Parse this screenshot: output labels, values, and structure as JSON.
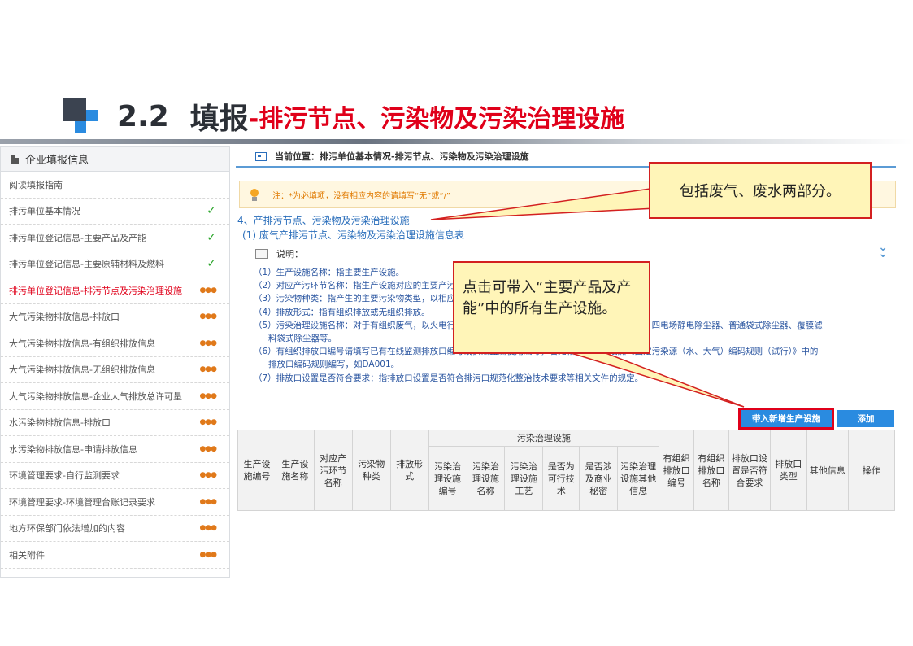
{
  "slide": {
    "number": "2.2",
    "title": "填报",
    "subtitle": "-排污节点、污染物及污染治理设施"
  },
  "sidebar": {
    "header": "企业填报信息",
    "items": [
      {
        "label": "阅读填报指南",
        "status": "none"
      },
      {
        "label": "排污单位基本情况",
        "status": "done"
      },
      {
        "label": "排污单位登记信息-主要产品及产能",
        "status": "done"
      },
      {
        "label": "排污单位登记信息-主要原辅材料及燃料",
        "status": "done"
      },
      {
        "label": "排污单位登记信息-排污节点及污染治理设施",
        "status": "pending",
        "active": true
      },
      {
        "label": "大气污染物排放信息-排放口",
        "status": "pending"
      },
      {
        "label": "大气污染物排放信息-有组织排放信息",
        "status": "pending"
      },
      {
        "label": "大气污染物排放信息-无组织排放信息",
        "status": "pending"
      },
      {
        "label": "大气污染物排放信息-企业大气排放总许可量",
        "status": "pending"
      },
      {
        "label": "水污染物排放信息-排放口",
        "status": "pending"
      },
      {
        "label": "水污染物排放信息-申请排放信息",
        "status": "pending"
      },
      {
        "label": "环境管理要求-自行监测要求",
        "status": "pending"
      },
      {
        "label": "环境管理要求-环境管理台账记录要求",
        "status": "pending"
      },
      {
        "label": "地方环保部门依法增加的内容",
        "status": "pending"
      },
      {
        "label": "相关附件",
        "status": "pending"
      }
    ]
  },
  "main": {
    "location": "当前位置：排污单位基本情况-排污节点、污染物及污染治理设施",
    "note": "注：*为必填项，没有相应内容的请填写“无”或“/”",
    "section": "4、产排污节点、污染物及污染治理设施",
    "subsection": "(1) 废气产排污节点、污染物及污染治理设施信息表",
    "explain_label": "说明：",
    "notes": [
      "（1）生产设施名称：指主要生产设施。",
      "（2）对应产污环节名称：指生产设施对应的主要产污环节名称。",
      "（3）污染物种类：指产生的主要污染物类型，以相应排放标准中确定的污染因子为准。",
      "（4）排放形式：指有组织排放或无组织排放。",
      "（5）污染治理设施名称：对于有组织废气，以火电行业为例，污染治理设施名称包括三电场静电除尘器、四电场静电除尘器、普通袋式除尘器、覆膜滤",
      "料袋式除尘器等。",
      "（6）有组织排放口编号请填写已有在线监测排放口编号或执法监测使用编号，若无相关编号可按照《固定污染源（水、大气）编码规则（试行）》中的",
      "排放口编码规则编写，如DA001。",
      "（7）排放口设置是否符合要求：指排放口设置是否符合排污口规范化整治技术要求等相关文件的规定。"
    ],
    "buttons": {
      "bring": "带入新增生产设施",
      "add": "添加"
    }
  },
  "table": {
    "group_header": "污染治理设施",
    "columns_before": [
      "生产设施编号",
      "生产设施名称",
      "对应产污环节名称",
      "污染物种类",
      "排放形式"
    ],
    "group_columns": [
      "污染治理设施编号",
      "污染治理设施名称",
      "污染治理设施工艺",
      "是否为可行技术",
      "是否涉及商业秘密",
      "污染治理设施其他信息"
    ],
    "columns_after": [
      "有组织排放口编号",
      "有组织排放口名称",
      "排放口设置是否符合要求",
      "排放口类型",
      "其他信息",
      "操作"
    ]
  },
  "callouts": {
    "one": "包括废气、废水两部分。",
    "two": "点击可带入“主要产品及产能”中的所有生产设施。"
  },
  "colors": {
    "accent_red": "#e0001a",
    "link_blue": "#2a6ebb",
    "button_blue": "#2a8be0",
    "callout_fill": "#fff5b8",
    "done_green": "#2aa52a"
  }
}
